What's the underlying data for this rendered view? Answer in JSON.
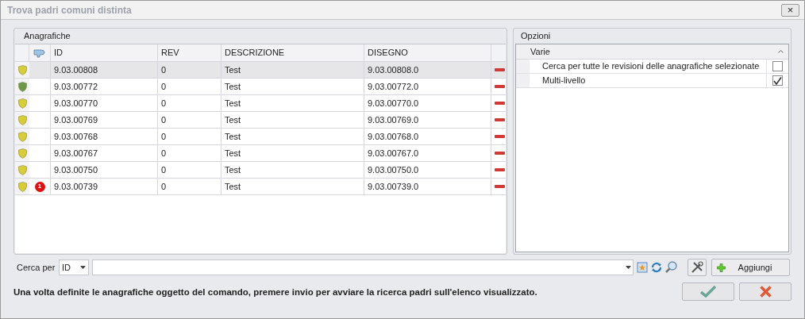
{
  "window": {
    "title": "Trova padri comuni distinta",
    "close": "×"
  },
  "grid": {
    "title": "Anagrafiche",
    "columns": [
      "ID",
      "REV",
      "DESCRIZIONE",
      "DISEGNO"
    ],
    "rows": [
      {
        "id": "9.03.00808",
        "rev": "0",
        "descrizione": "Test",
        "disegno": "9.03.00808.0",
        "color": "#d8cc3a",
        "selected": true
      },
      {
        "id": "9.03.00772",
        "rev": "0",
        "descrizione": "Test",
        "disegno": "9.03.00772.0",
        "color": "#6a9a48",
        "selected": false
      },
      {
        "id": "9.03.00770",
        "rev": "0",
        "descrizione": "Test",
        "disegno": "9.03.00770.0",
        "color": "#d8cc3a",
        "selected": false
      },
      {
        "id": "9.03.00769",
        "rev": "0",
        "descrizione": "Test",
        "disegno": "9.03.00769.0",
        "color": "#d8cc3a",
        "selected": false
      },
      {
        "id": "9.03.00768",
        "rev": "0",
        "descrizione": "Test",
        "disegno": "9.03.00768.0",
        "color": "#d8cc3a",
        "selected": false
      },
      {
        "id": "9.03.00767",
        "rev": "0",
        "descrizione": "Test",
        "disegno": "9.03.00767.0",
        "color": "#d8cc3a",
        "selected": false
      },
      {
        "id": "9.03.00750",
        "rev": "0",
        "descrizione": "Test",
        "disegno": "9.03.00750.0",
        "color": "#d8cc3a",
        "selected": false
      },
      {
        "id": "9.03.00739",
        "rev": "0",
        "descrizione": "Test",
        "disegno": "9.03.00739.0",
        "color": "#d8cc3a",
        "selected": false,
        "badge": "1"
      }
    ]
  },
  "options": {
    "title": "Opzioni",
    "category": "Varie",
    "expanded": true,
    "items": [
      {
        "label": "Cerca per tutte le revisioni delle anagrafiche selezionate",
        "checked": false
      },
      {
        "label": "Multi-livello",
        "checked": true
      }
    ]
  },
  "search": {
    "label": "Cerca per",
    "field": "ID"
  },
  "add_button": "Aggiungi",
  "message": "Una volta definite le anagrafiche oggetto del comando, premere invio per avviare la ricerca padri sull'elenco visualizzato."
}
